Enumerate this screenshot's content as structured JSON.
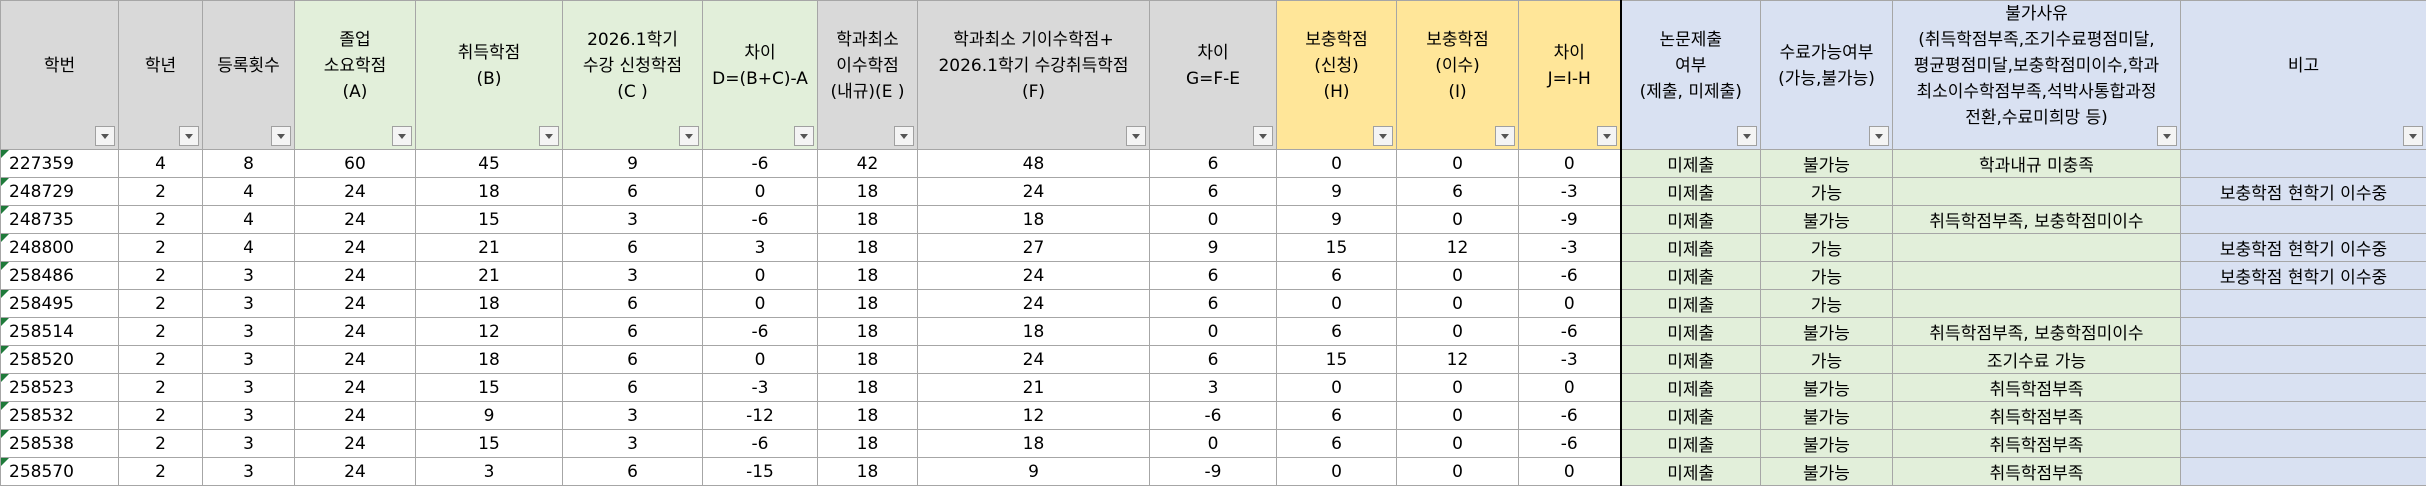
{
  "headers": [
    {
      "lines": [
        "학번"
      ]
    },
    {
      "lines": [
        "학년"
      ]
    },
    {
      "lines": [
        "등록횟수"
      ]
    },
    {
      "lines": [
        "졸업",
        "소요학점",
        "(A)"
      ]
    },
    {
      "lines": [
        "취득학점",
        "(B)"
      ]
    },
    {
      "lines": [
        "2026.1학기",
        "수강 신청학점",
        "(C )"
      ]
    },
    {
      "lines": [
        "차이",
        "D=(B+C)-A"
      ]
    },
    {
      "lines": [
        "학과최소",
        "이수학점",
        "(내규)(E )"
      ]
    },
    {
      "lines": [
        "학과최소 기이수학점+",
        "2026.1학기 수강취득학점",
        "(F)"
      ]
    },
    {
      "lines": [
        "차이",
        "G=F-E"
      ]
    },
    {
      "lines": [
        "보충학점",
        "(신청)",
        "(H)"
      ]
    },
    {
      "lines": [
        "보충학점",
        "(이수)",
        "(I)"
      ]
    },
    {
      "lines": [
        "차이",
        "J=I-H"
      ]
    },
    {
      "lines": [
        "논문제출",
        "여부",
        "(제출, 미제출)"
      ]
    },
    {
      "lines": [
        "수료가능여부",
        "(가능,불가능)"
      ]
    },
    {
      "lines": [
        "불가사유",
        "(취득학점부족,조기수료평점미달,",
        "평균평점미달,보충학점미이수,학과",
        "최소이수학점부족,석박사통합과정",
        "전환,수료미희망 등)"
      ]
    },
    {
      "lines": [
        "비고"
      ]
    }
  ],
  "rows": [
    [
      "227359",
      "4",
      "8",
      "60",
      "45",
      "9",
      "-6",
      "42",
      "48",
      "6",
      "0",
      "0",
      "0",
      "미제출",
      "불가능",
      "학과내규 미충족",
      ""
    ],
    [
      "248729",
      "2",
      "4",
      "24",
      "18",
      "6",
      "0",
      "18",
      "24",
      "6",
      "9",
      "6",
      "-3",
      "미제출",
      "가능",
      "",
      "보충학점 현학기 이수중"
    ],
    [
      "248735",
      "2",
      "4",
      "24",
      "15",
      "3",
      "-6",
      "18",
      "18",
      "0",
      "9",
      "0",
      "-9",
      "미제출",
      "불가능",
      "취득학점부족, 보충학점미이수",
      ""
    ],
    [
      "248800",
      "2",
      "4",
      "24",
      "21",
      "6",
      "3",
      "18",
      "27",
      "9",
      "15",
      "12",
      "-3",
      "미제출",
      "가능",
      "",
      "보충학점 현학기 이수중"
    ],
    [
      "258486",
      "2",
      "3",
      "24",
      "21",
      "3",
      "0",
      "18",
      "24",
      "6",
      "6",
      "0",
      "-6",
      "미제출",
      "가능",
      "",
      "보충학점 현학기 이수중"
    ],
    [
      "258495",
      "2",
      "3",
      "24",
      "18",
      "6",
      "0",
      "18",
      "24",
      "6",
      "0",
      "0",
      "0",
      "미제출",
      "가능",
      "",
      ""
    ],
    [
      "258514",
      "2",
      "3",
      "24",
      "12",
      "6",
      "-6",
      "18",
      "18",
      "0",
      "6",
      "0",
      "-6",
      "미제출",
      "불가능",
      "취득학점부족, 보충학점미이수",
      ""
    ],
    [
      "258520",
      "2",
      "3",
      "24",
      "18",
      "6",
      "0",
      "18",
      "24",
      "6",
      "15",
      "12",
      "-3",
      "미제출",
      "가능",
      "조기수료 가능",
      ""
    ],
    [
      "258523",
      "2",
      "3",
      "24",
      "15",
      "6",
      "-3",
      "18",
      "21",
      "3",
      "0",
      "0",
      "0",
      "미제출",
      "불가능",
      "취득학점부족",
      ""
    ],
    [
      "258532",
      "2",
      "3",
      "24",
      "9",
      "3",
      "-12",
      "18",
      "12",
      "-6",
      "6",
      "0",
      "-6",
      "미제출",
      "불가능",
      "취득학점부족",
      ""
    ],
    [
      "258538",
      "2",
      "3",
      "24",
      "15",
      "3",
      "-6",
      "18",
      "18",
      "0",
      "6",
      "0",
      "-6",
      "미제출",
      "불가능",
      "취득학점부족",
      ""
    ],
    [
      "258570",
      "2",
      "3",
      "24",
      "3",
      "6",
      "-15",
      "18",
      "9",
      "-9",
      "0",
      "0",
      "0",
      "미제출",
      "불가능",
      "취득학점부족",
      ""
    ]
  ],
  "colors": {
    "header_gray": "#d9d9d9",
    "header_green": "#e2efda",
    "header_yellow": "#ffe699",
    "header_blue": "#d9e1f2",
    "highlight_red": "#ff0000"
  }
}
